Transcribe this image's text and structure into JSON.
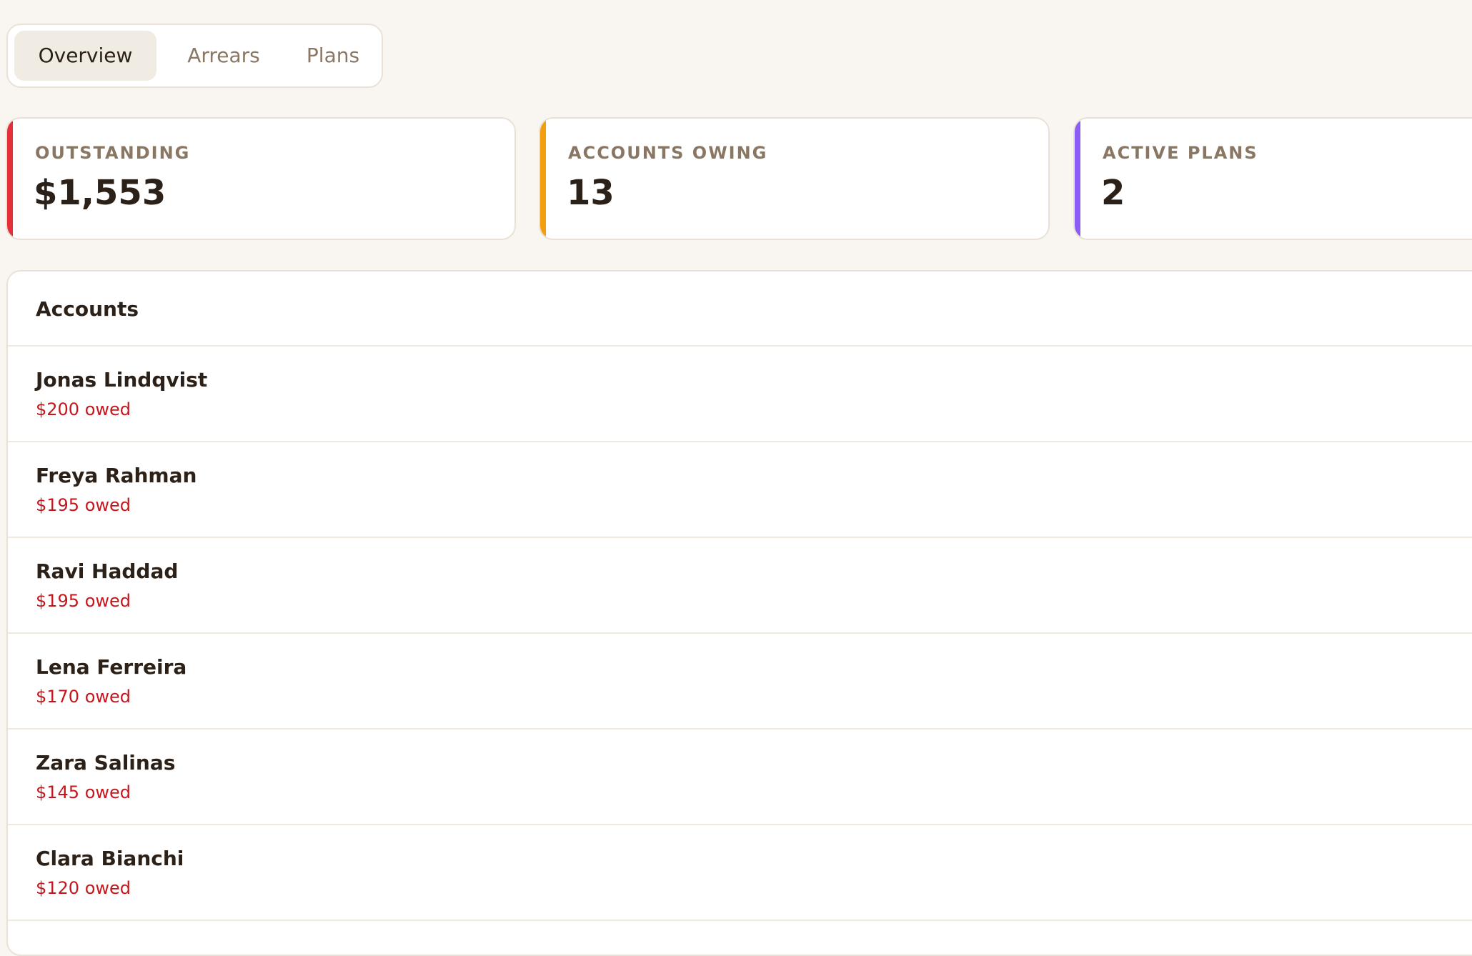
{
  "tabs": [
    {
      "label": "Overview",
      "active": true
    },
    {
      "label": "Arrears",
      "active": false
    },
    {
      "label": "Plans",
      "active": false
    }
  ],
  "stats": [
    {
      "label": "OUTSTANDING",
      "value": "$1,553",
      "accent": "#e5303a"
    },
    {
      "label": "ACCOUNTS OWING",
      "value": "13",
      "accent": "#f59e0b"
    },
    {
      "label": "ACTIVE PLANS",
      "value": "2",
      "accent": "#8b5cf6"
    }
  ],
  "accounts": {
    "title": "Accounts",
    "rows": [
      {
        "name": "Jonas Lindqvist",
        "owed": "$200 owed"
      },
      {
        "name": "Freya Rahman",
        "owed": "$195 owed"
      },
      {
        "name": "Ravi Haddad",
        "owed": "$195 owed"
      },
      {
        "name": "Lena Ferreira",
        "owed": "$170 owed"
      },
      {
        "name": "Zara Salinas",
        "owed": "$145 owed"
      },
      {
        "name": "Clara Bianchi",
        "owed": "$120 owed"
      }
    ]
  },
  "colors": {
    "background": "#f9f6f1",
    "owed_text": "#c4161c",
    "muted_text": "#8a7763"
  }
}
